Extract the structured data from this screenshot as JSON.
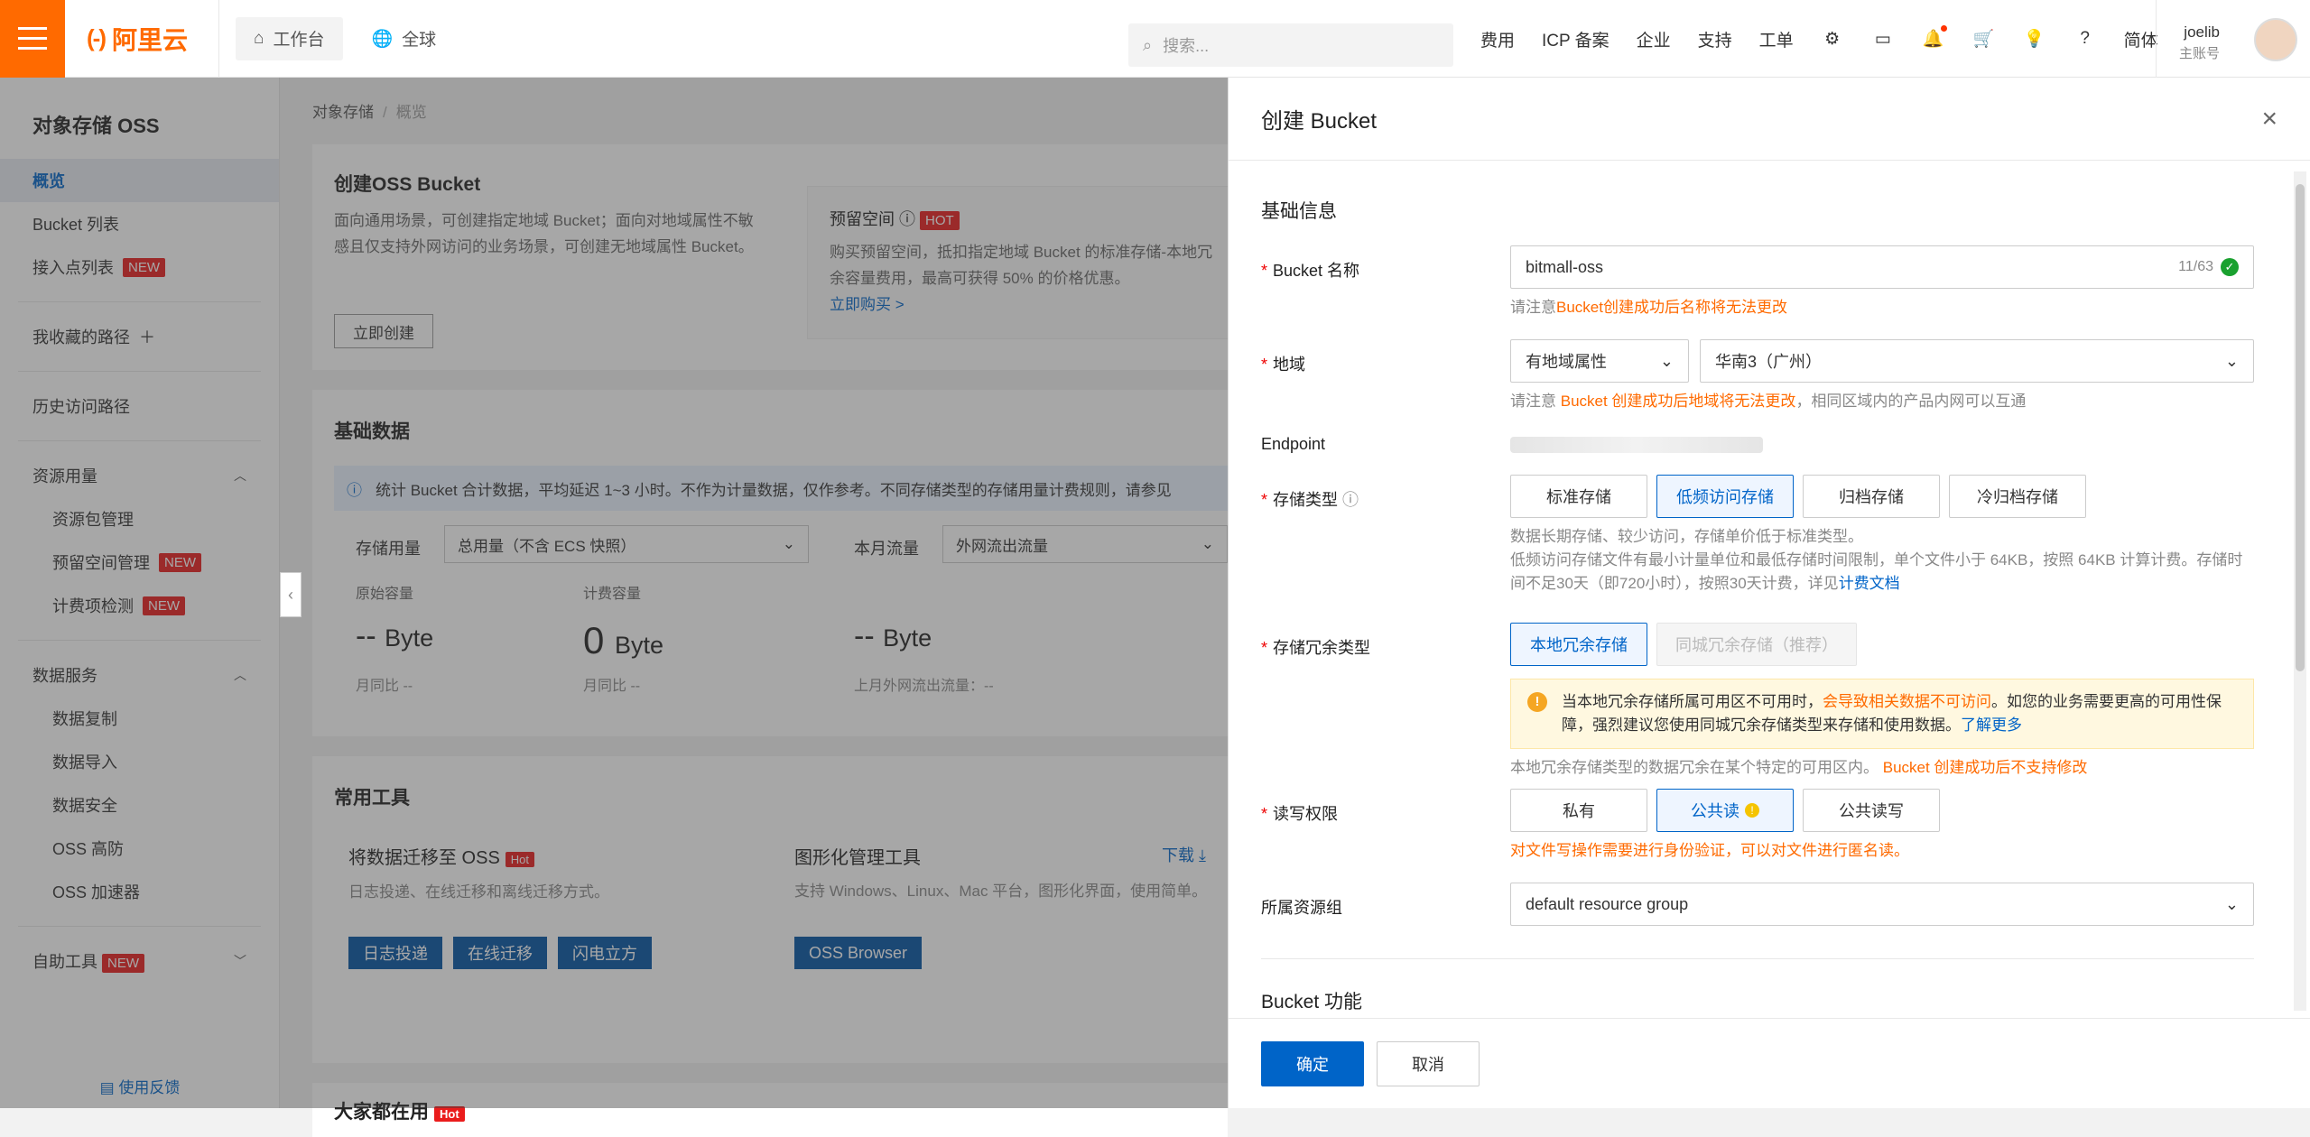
{
  "topbar": {
    "logo": "阿里云",
    "workbench": "工作台",
    "global": "全球",
    "search_placeholder": "搜索...",
    "links": [
      "费用",
      "ICP 备案",
      "企业",
      "支持",
      "工单"
    ],
    "lang": "简体",
    "user_name": "joelib",
    "user_role": "主账号"
  },
  "sidebar": {
    "title": "对象存储 OSS",
    "items": [
      "概览",
      "Bucket 列表",
      "接入点列表"
    ],
    "new_badge": "NEW",
    "favorites": "我收藏的路径",
    "history": "历史访问路径",
    "resource_group": "资源用量",
    "resource_items": [
      "资源包管理",
      "预留空间管理",
      "计费项检测"
    ],
    "data_group": "数据服务",
    "data_items": [
      "数据复制",
      "数据导入",
      "数据安全",
      "OSS 高防",
      "OSS 加速器"
    ],
    "self_tools": "自助工具",
    "feedback": "使用反馈"
  },
  "main": {
    "crumb_root": "对象存储",
    "crumb_current": "概览",
    "create_title": "创建OSS Bucket",
    "create_desc": "面向通用场景，可创建指定地域 Bucket；面向对地域属性不敏感且仅支持外网访问的业务场景，可创建无地域属性 Bucket。",
    "create_btn": "立即创建",
    "reserve_title": "预留空间",
    "reserve_hot": "HOT",
    "reserve_desc": "购买预留空间，抵扣指定地域 Bucket 的标准存储-本地冗余容量费用，最高可获得 50% 的价格优惠。",
    "reserve_link": "立即购买 >",
    "basic_title": "基础数据",
    "basic_info": "统计 Bucket 合计数据，平均延迟 1~3 小时。不作为计量数据，仅作参考。不同存储类型的存储用量计费规则，请参见",
    "storage_label": "存储用量",
    "storage_select": "总用量（不含 ECS 快照）",
    "traffic_label": "本月流量",
    "traffic_select": "外网流出流量",
    "raw_label": "原始容量",
    "billed_label": "计费容量",
    "raw_value": "--",
    "raw_unit": "Byte",
    "billed_value": "0",
    "billed_unit": "Byte",
    "traffic_value": "--",
    "traffic_unit": "Byte",
    "mom": "月同比 --",
    "mom2": "月同比 --",
    "last_month": "上月外网流出流量：--",
    "tools_title": "常用工具",
    "migrate_title": "将数据迁移至 OSS",
    "migrate_hot": "Hot",
    "migrate_desc": "日志投递、在线迁移和离线迁移方式。",
    "migrate_btns": [
      "日志投递",
      "在线迁移",
      "闪电立方"
    ],
    "gui_title": "图形化管理工具",
    "gui_download": "下载",
    "gui_desc": "支持 Windows、Linux、Mac 平台，图形化界面，使用简单。",
    "gui_btn": "OSS Browser",
    "popular_title": "大家都在用",
    "popular_hot": "Hot"
  },
  "drawer": {
    "title": "创建 Bucket",
    "section_basic": "基础信息",
    "bucket_name_label": "Bucket 名称",
    "bucket_name_value": "bitmall-oss",
    "bucket_name_count": "11/63",
    "bucket_name_hint_pre": "请注意",
    "bucket_name_hint_warn": "Bucket创建成功后名称将无法更改",
    "region_label": "地域",
    "region_type": "有地域属性",
    "region_value": "华南3（广州）",
    "region_hint_pre": "请注意 ",
    "region_hint_warn": "Bucket 创建成功后地域将无法更改",
    "region_hint_post": "，相同区域内的产品内网可以互通",
    "endpoint_label": "Endpoint",
    "storage_class_label": "存储类型",
    "storage_classes": [
      "标准存储",
      "低频访问存储",
      "归档存储",
      "冷归档存储"
    ],
    "storage_hint1": "数据长期存储、较少访问，存储单价低于标准类型。",
    "storage_hint2": "低频访问存储文件有最小计量单位和最低存储时间限制，单个文件小于 64KB，按照 64KB 计算计费。存储时间不足30天（即720小时），按照30天计费，详见",
    "storage_hint_link": "计费文档",
    "redundancy_label": "存储冗余类型",
    "redundancy_options": [
      "本地冗余存储",
      "同城冗余存储（推荐）"
    ],
    "redundancy_notice_pre": "当本地冗余存储所属可用区不可用时，",
    "redundancy_notice_warn": "会导致相关数据不可访问",
    "redundancy_notice_post": "。如您的业务需要更高的可用性保障，强烈建议您使用同城冗余存储类型来存储和使用数据。",
    "redundancy_notice_link": "了解更多",
    "redundancy_hint_pre": "本地冗余存储类型的数据冗余在某个特定的可用区内。 ",
    "redundancy_hint_warn": "Bucket 创建成功后不支持修改",
    "acl_label": "读写权限",
    "acl_options": [
      "私有",
      "公共读",
      "公共读写"
    ],
    "acl_hint": "对文件写操作需要进行身份验证，可以对文件进行匿名读。",
    "rg_label": "所属资源组",
    "rg_value": "default resource group",
    "section_features": "Bucket 功能",
    "confirm": "确定",
    "cancel": "取消"
  },
  "colors": {
    "brand": "#ff6a00",
    "primary": "#0064c8",
    "danger": "#ea1c1c"
  }
}
